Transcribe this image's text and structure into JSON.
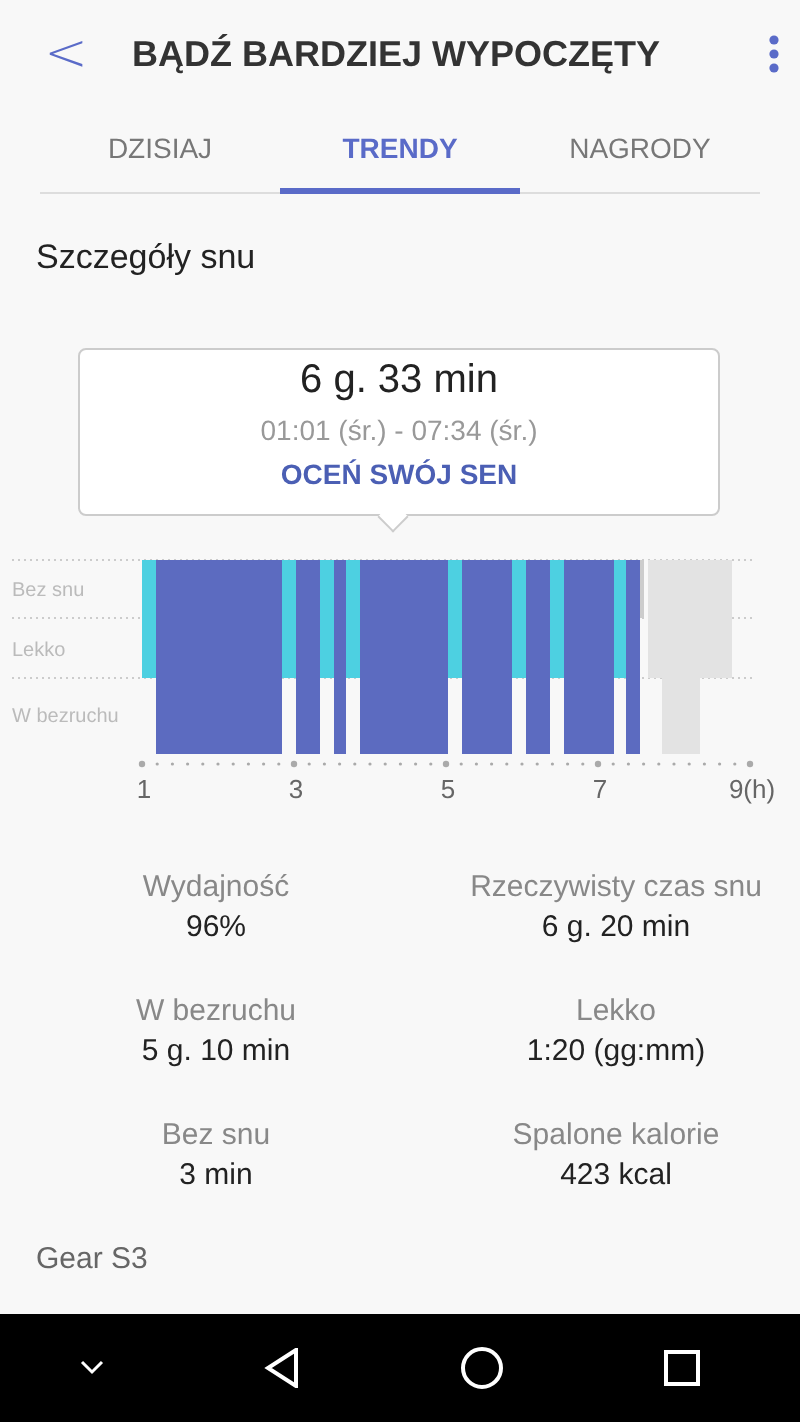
{
  "header": {
    "back": "<",
    "title": "BĄDŹ BARDZIEJ WYPOCZĘTY"
  },
  "tabs": [
    {
      "label": "DZISIAJ",
      "selected": false
    },
    {
      "label": "TRENDY",
      "selected": true
    },
    {
      "label": "NAGRODY",
      "selected": false
    }
  ],
  "section_title": "Szczegóły snu",
  "summary": {
    "duration": "6 g. 33 min",
    "range": "01:01 (śr.) - 07:34 (śr.)",
    "action": "OCEŃ SWÓJ SEN"
  },
  "sleep_chart": {
    "row_labels": [
      "Bez snu",
      "Lekko",
      "W bezruchu"
    ],
    "x_labels": [
      "1",
      "3",
      "5",
      "7",
      "9(h)"
    ]
  },
  "stats": [
    {
      "label": "Wydajność",
      "value": "96%"
    },
    {
      "label": "Rzeczywisty czas snu",
      "value": "6 g. 20 min"
    },
    {
      "label": "W bezruchu",
      "value": "5 g. 10 min"
    },
    {
      "label": "Lekko",
      "value": "1:20 (gg:mm)"
    },
    {
      "label": "Bez snu",
      "value": "3 min"
    },
    {
      "label": "Spalone kalorie",
      "value": "423 kcal"
    }
  ],
  "device": "Gear S3"
}
